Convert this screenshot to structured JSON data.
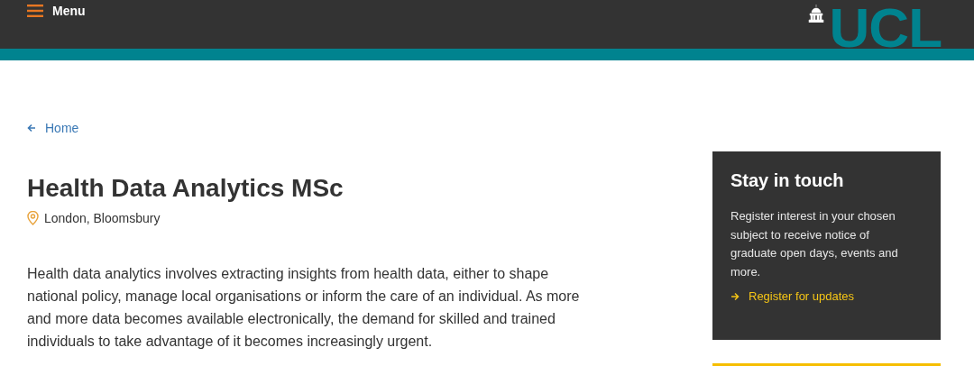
{
  "header": {
    "menu_label": "Menu",
    "logo": "UCL"
  },
  "breadcrumb": {
    "label": "Home"
  },
  "title": "Health Data Analytics MSc",
  "location": "London, Bloomsbury",
  "intro": "Health data analytics involves extracting insights from health data, either to shape national policy, manage local organisations or inform the care of an individual. As more and more data becomes available electronically, the demand for skilled and trained individuals to take advantage of it becomes increasingly urgent.",
  "sidebar": {
    "title": "Stay in touch",
    "text": "Register interest in your chosen subject to receive notice of graduate open days, events and more.",
    "link": "Register for updates"
  }
}
